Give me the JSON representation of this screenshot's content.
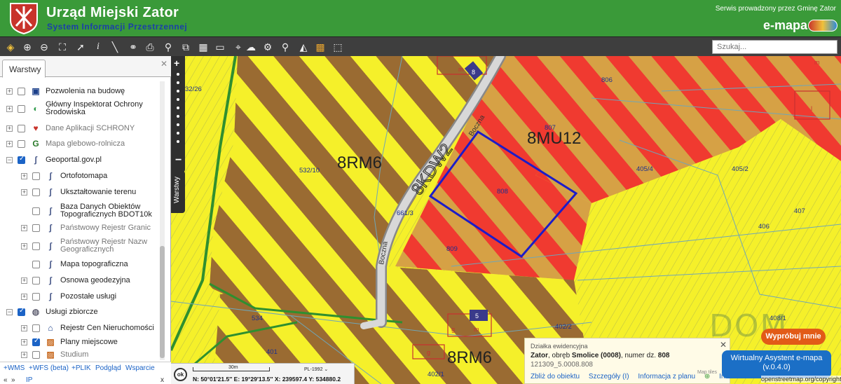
{
  "header": {
    "town_name": "Urząd Miejski Zator",
    "system_name": "System Informacji Przestrzennej",
    "served_by": "Serwis prowadzony przez Gminę Zator",
    "logo_text": "e-mapa",
    "crest_icon": "town-crest",
    "colors": {
      "bar": "#3a9a39",
      "subtitle": "#1b3fa8"
    }
  },
  "toolbar": {
    "search_placeholder": "Szukaj..."
  },
  "panel": {
    "tab_label": "Warstwy",
    "layers": [
      {
        "label": "Pozwolenia na budowę",
        "checked": false,
        "icon": "building-permit-icon",
        "expandable": true
      },
      {
        "label": "Główny Inspektorat Ochrony Środowiska",
        "checked": false,
        "icon": "gios-icon",
        "expandable": true
      },
      {
        "label": "Dane Aplikacji SCHRONY",
        "checked": false,
        "icon": "shield-icon",
        "expandable": true
      },
      {
        "label": "Mapa glebowo-rolnicza",
        "checked": false,
        "icon": "soil-map-icon",
        "expandable": true
      },
      {
        "label": "Geoportal.gov.pl",
        "checked": true,
        "icon": "geoportal-icon",
        "expandable": true,
        "expanded": true
      },
      {
        "label": "Ortofotomapa",
        "checked": false,
        "icon": "geoportal-icon",
        "expandable": true
      },
      {
        "label": "Ukształtowanie terenu",
        "checked": false,
        "icon": "geoportal-icon",
        "expandable": true
      },
      {
        "label": "Baza Danych Obiektów Topograficznych BDOT10k",
        "checked": false,
        "icon": "geoportal-icon",
        "expandable": false
      },
      {
        "label": "Państwowy Rejestr Granic",
        "checked": false,
        "icon": "geoportal-icon",
        "expandable": true
      },
      {
        "label": "Państwowy Rejestr Nazw Geograficznych",
        "checked": false,
        "icon": "geoportal-icon",
        "expandable": true
      },
      {
        "label": "Mapa topograficzna",
        "checked": false,
        "icon": "geoportal-icon",
        "expandable": false
      },
      {
        "label": "Osnowa geodezyjna",
        "checked": false,
        "icon": "geoportal-icon",
        "expandable": true
      },
      {
        "label": "Pozostałe usługi",
        "checked": false,
        "icon": "geoportal-icon",
        "expandable": true
      },
      {
        "label": "Usługi zbiorcze",
        "checked": true,
        "icon": "globe-icon",
        "expandable": true,
        "expanded": true
      },
      {
        "label": "Rejestr Cen Nieruchomości",
        "checked": false,
        "icon": "house-icon",
        "expandable": true
      },
      {
        "label": "Plany miejscowe",
        "checked": true,
        "icon": "plan-icon",
        "expandable": true
      },
      {
        "label": "Studium",
        "checked": false,
        "icon": "plan-icon",
        "expandable": true
      }
    ],
    "footer_links": [
      "+WMS",
      "+WFS (beta)",
      "+PLIK",
      "Podgląd",
      "Wsparcie"
    ],
    "footer_small": [
      "«",
      "»",
      "IP",
      "x"
    ]
  },
  "map": {
    "zones": [
      "8RM6",
      "8MU12",
      "8RM6"
    ],
    "road_label": "8KDW2",
    "street_label": "Boczna",
    "parcels": [
      "32/26",
      "532/10",
      "806",
      "807",
      "808",
      "809",
      "661/3",
      "405/4",
      "405/2",
      "407",
      "406",
      "534",
      "401",
      "402/2",
      "402/1",
      "408/1"
    ],
    "symbols": [
      "m",
      "m",
      "m",
      "g",
      "g",
      "5",
      "8",
      "l"
    ],
    "layers_tab_label": "Warstwy"
  },
  "status": {
    "ok_label": "ok",
    "scale_label": "30m",
    "crs": "PL-1992",
    "coords": "N: 50°01′21.5″  E: 19°29′13.5″  X: 239597.4  Y: 534880.2"
  },
  "popup": {
    "title": "Działka ewidencyjna",
    "town": "Zator",
    "precinct_text": ", obręb ",
    "precinct": "Smolice (0008)",
    "number_text": ", numer dz. ",
    "number": "808",
    "identifier": "121309_5.0008.808",
    "links": [
      "Zbliż do obiektu",
      "Szczegóły (I)",
      "Informacja z planu",
      "Inne"
    ]
  },
  "widgets": {
    "try_label": "Wypróbuj mnie",
    "assistant_line1": "Wirtualny Asystent e-mapa",
    "assistant_line2": "(v.0.4.0)",
    "osm_attribution": "openstreetmap.org/copyright",
    "map_tiles": "Map tiles",
    "watermark": "DOM"
  }
}
